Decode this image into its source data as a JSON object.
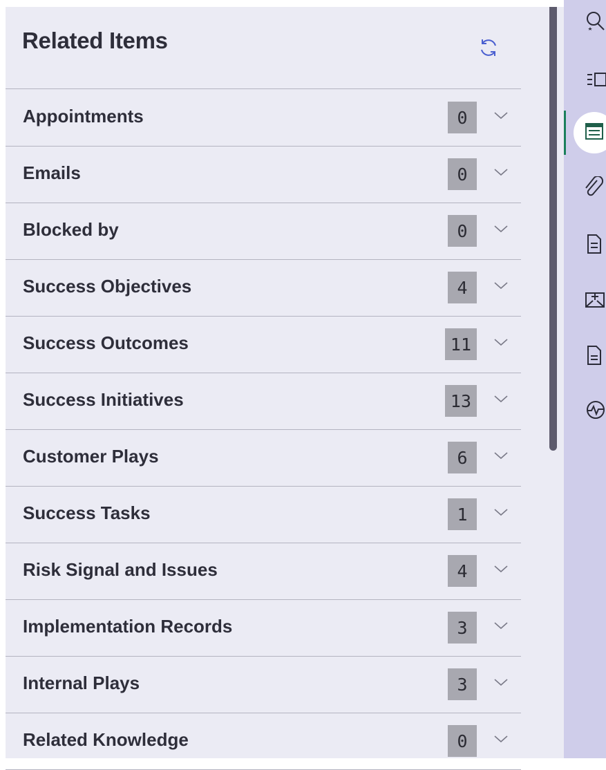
{
  "panel": {
    "title": "Related Items",
    "refresh_icon": "refresh-icon"
  },
  "items": [
    {
      "label": "Appointments",
      "count": "0"
    },
    {
      "label": "Emails",
      "count": "0"
    },
    {
      "label": "Blocked by",
      "count": "0"
    },
    {
      "label": "Success Objectives",
      "count": "4"
    },
    {
      "label": "Success Outcomes",
      "count": "11"
    },
    {
      "label": "Success Initiatives",
      "count": "13"
    },
    {
      "label": "Customer Plays",
      "count": "6"
    },
    {
      "label": "Success Tasks",
      "count": "1"
    },
    {
      "label": "Risk Signal and Issues",
      "count": "4"
    },
    {
      "label": "Implementation Records",
      "count": "3"
    },
    {
      "label": "Internal Plays",
      "count": "3"
    },
    {
      "label": "Related Knowledge",
      "count": "0"
    }
  ],
  "rail": {
    "icons": [
      "search-assist-icon",
      "summary-icon",
      "related-items-icon",
      "attachments-icon",
      "document-icon",
      "email-icon",
      "notes-icon",
      "activity-icon"
    ],
    "active": "related-items-icon"
  },
  "colors": {
    "panel_bg": "#ebebf4",
    "rail_bg": "#cfcdea",
    "badge_bg": "#a8a8b0",
    "active_indicator": "#1a7f5a",
    "refresh_icon": "#4a5fd0"
  }
}
